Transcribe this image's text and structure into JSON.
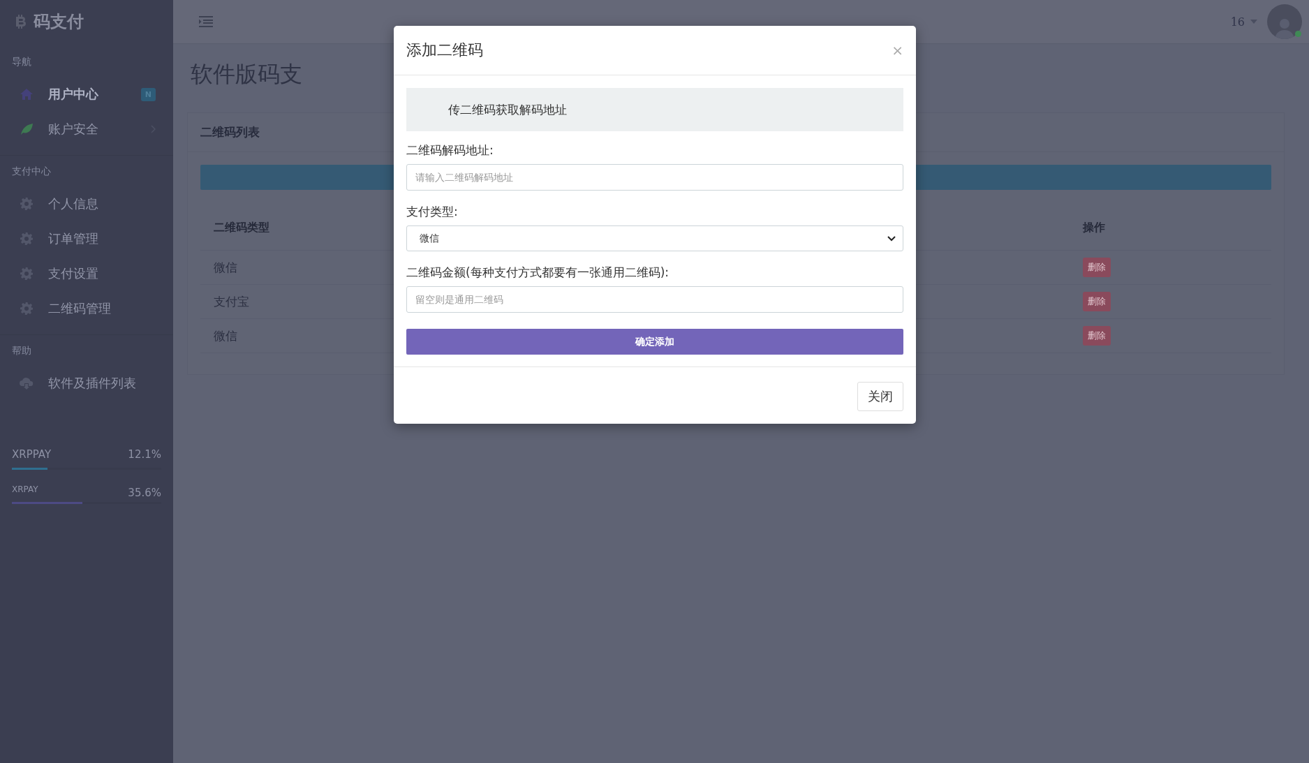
{
  "sidebar": {
    "brand": "码支付",
    "sections": [
      {
        "heading": "导航",
        "items": [
          {
            "label": "用户中心",
            "kind": "home",
            "selected": true,
            "badge": "N",
            "has_submenu": false
          },
          {
            "label": "账户安全",
            "kind": "leaf",
            "selected": false,
            "has_submenu": true
          }
        ]
      },
      {
        "heading": "支付中心",
        "items": [
          {
            "label": "个人信息",
            "kind": "gear",
            "selected": false,
            "has_submenu": false
          },
          {
            "label": "订单管理",
            "kind": "gear",
            "selected": false,
            "has_submenu": false
          },
          {
            "label": "支付设置",
            "kind": "gear",
            "selected": false,
            "has_submenu": false
          },
          {
            "label": "二维码管理",
            "kind": "gear",
            "selected": false,
            "has_submenu": false
          }
        ]
      },
      {
        "heading": "帮助",
        "items": [
          {
            "label": "软件及插件列表",
            "kind": "cloud",
            "selected": false,
            "has_submenu": false
          }
        ]
      }
    ],
    "meters": [
      {
        "name": "XRPPAY",
        "reading": "12.1%",
        "level": 0.24,
        "color": "#2f6f90"
      },
      {
        "name": "XRPAY",
        "reading": "35.6%",
        "level": 0.47,
        "color": "#4d4a84"
      }
    ]
  },
  "header": {
    "user": "16",
    "online": true
  },
  "page_title": "软件版码支",
  "card": {
    "title": "二维码列表",
    "table": {
      "columns": [
        "二维码类型",
        "操作"
      ],
      "rows": [
        {
          "type": "微信",
          "action": "删除"
        },
        {
          "type": "支付宝",
          "action": "删除"
        },
        {
          "type": "微信",
          "action": "删除"
        }
      ]
    }
  },
  "modal": {
    "title": "添加二维码",
    "close": "×",
    "alert": "传二维码获取解码地址",
    "fields": [
      {
        "kind": "input",
        "label": "二维码解码地址:",
        "placeholder": "请输入二维码解码地址"
      },
      {
        "kind": "select",
        "label": "支付类型:",
        "value": "微信"
      },
      {
        "kind": "input",
        "label": "二维码金额(每种支付方式都要有一张通用二维码):",
        "placeholder": "留空则是通用二维码"
      }
    ],
    "submit": "确定添加",
    "footer_button": "关闭"
  }
}
